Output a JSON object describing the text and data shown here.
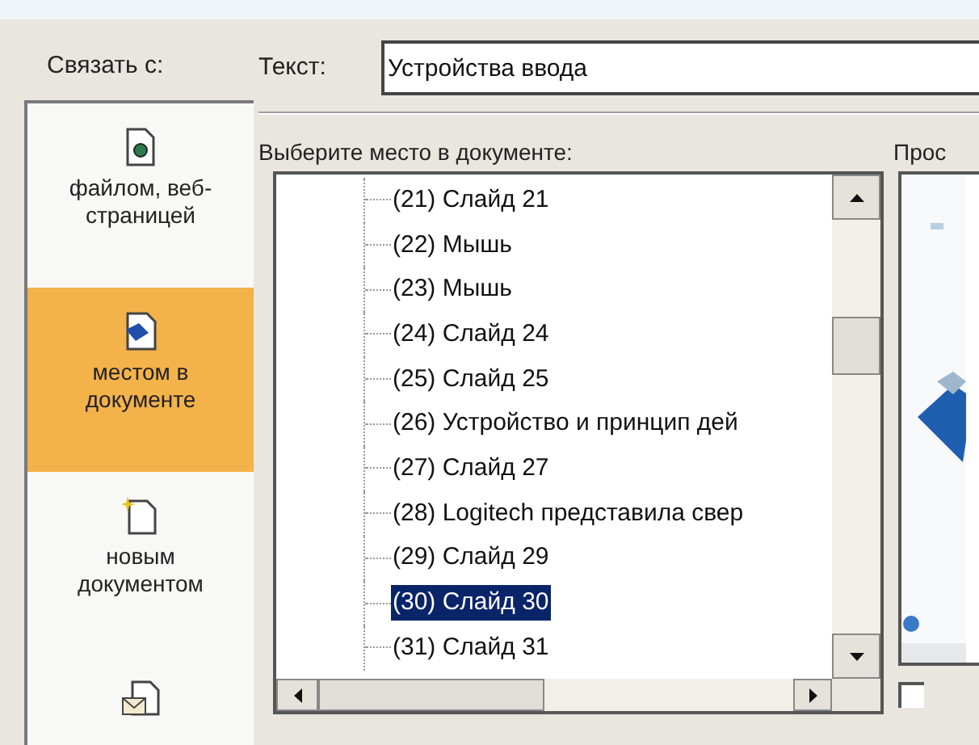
{
  "sidebar": {
    "title": "Связать с:",
    "items": [
      {
        "kind": "file",
        "label": "файлом, веб-страницей",
        "selected": false
      },
      {
        "kind": "place",
        "label": "местом в документе",
        "selected": true
      },
      {
        "kind": "new",
        "label": "новым документом",
        "selected": false
      },
      {
        "kind": "email",
        "selected": false
      }
    ]
  },
  "text_field": {
    "label": "Текст:",
    "value": "Устройства ввода"
  },
  "place_list": {
    "label": "Выберите место в документе:",
    "items": [
      {
        "label": "(21) Слайд 21",
        "selected": false
      },
      {
        "label": "(22) Мышь",
        "selected": false
      },
      {
        "label": "(23) Мышь",
        "selected": false
      },
      {
        "label": "(24) Слайд 24",
        "selected": false
      },
      {
        "label": "(25) Слайд 25",
        "selected": false
      },
      {
        "label": "(26) Устройство и принцип дей",
        "selected": false
      },
      {
        "label": "(27) Слайд 27",
        "selected": false
      },
      {
        "label": "(28) Logitech представила свер",
        "selected": false
      },
      {
        "label": "(29) Слайд 29",
        "selected": false
      },
      {
        "label": "(30) Слайд 30",
        "selected": true
      },
      {
        "label": "(31) Слайд 31",
        "selected": false
      }
    ]
  },
  "preview": {
    "label": "Прос",
    "show_checkbox": {
      "checked": false
    }
  }
}
